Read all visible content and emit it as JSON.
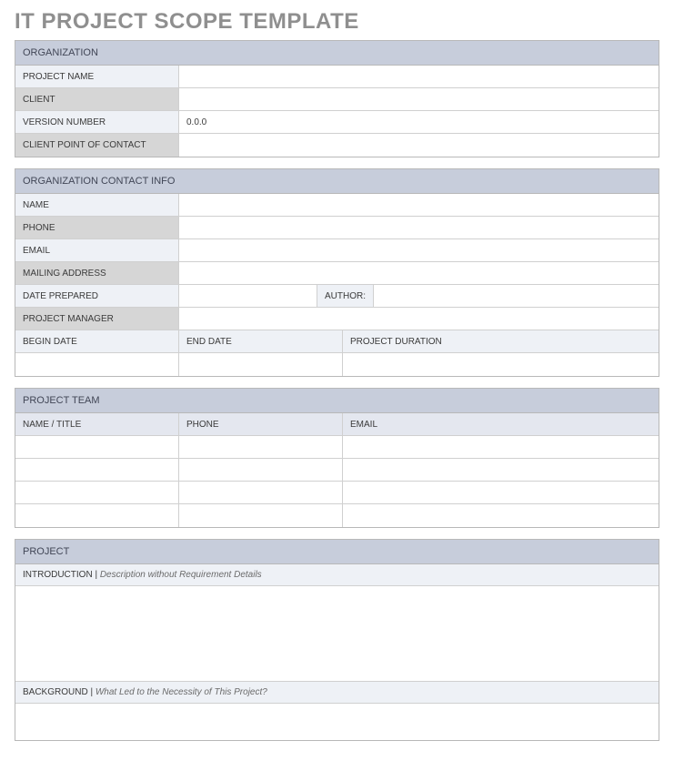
{
  "title": "IT PROJECT SCOPE TEMPLATE",
  "organization": {
    "header": "ORGANIZATION",
    "labels": {
      "projectName": "PROJECT NAME",
      "client": "CLIENT",
      "versionNumber": "VERSION NUMBER",
      "clientPoc": "CLIENT POINT OF CONTACT"
    },
    "values": {
      "projectName": "",
      "client": "",
      "versionNumber": "0.0.0",
      "clientPoc": ""
    }
  },
  "contact": {
    "header": "ORGANIZATION CONTACT INFO",
    "labels": {
      "name": "NAME",
      "phone": "PHONE",
      "email": "EMAIL",
      "mailing": "MAILING ADDRESS",
      "datePrepared": "DATE PREPARED",
      "author": "AUTHOR:",
      "projectManager": "PROJECT MANAGER",
      "beginDate": "BEGIN DATE",
      "endDate": "END DATE",
      "projectDuration": "PROJECT DURATION"
    },
    "values": {
      "name": "",
      "phone": "",
      "email": "",
      "mailing": "",
      "datePrepared": "",
      "author": "",
      "projectManager": "",
      "beginDate": "",
      "endDate": "",
      "projectDuration": ""
    }
  },
  "team": {
    "header": "PROJECT TEAM",
    "columns": {
      "name": "NAME / TITLE",
      "phone": "PHONE",
      "email": "EMAIL"
    },
    "rows": [
      {
        "name": "",
        "phone": "",
        "email": ""
      },
      {
        "name": "",
        "phone": "",
        "email": ""
      },
      {
        "name": "",
        "phone": "",
        "email": ""
      },
      {
        "name": "",
        "phone": "",
        "email": ""
      }
    ]
  },
  "project": {
    "header": "PROJECT",
    "intro": {
      "label": "INTRODUCTION |",
      "hint": "Description without Requirement Details",
      "value": ""
    },
    "background": {
      "label": "BACKGROUND |",
      "hint": "What Led to the Necessity of This Project?",
      "value": ""
    }
  }
}
